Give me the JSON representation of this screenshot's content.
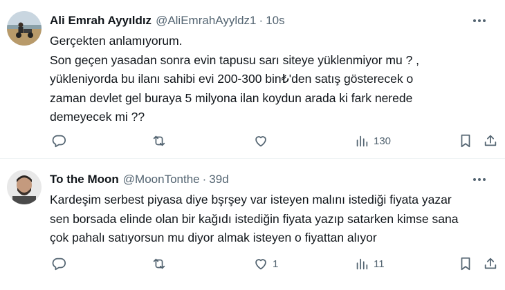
{
  "tweets": [
    {
      "name": "Ali Emrah Ayyıldız",
      "handle": "@AliEmrahAyyldz1",
      "separator": "·",
      "time": "10s",
      "more_icon": "ellipsis-icon",
      "lines": [
        "Gerçekten anlamıyorum.",
        "Son geçen yasadan sonra evin tapusu sarı siteye yüklenmiyor mu ? ,",
        "yükleniyorda bu ilanı sahibi evi 200-300 bin₺'den satış gösterecek o",
        "zaman devlet gel buraya 5 milyona ilan koydun arada ki fark nerede",
        "demeyecek mi ??"
      ],
      "actions": {
        "reply": "",
        "retweet": "",
        "like": "",
        "views": "130"
      }
    },
    {
      "name": "To the Moon",
      "handle": "@MoonTonthe",
      "separator": "·",
      "time": "39d",
      "more_icon": "ellipsis-icon",
      "lines": [
        "Kardeşim serbest piyasa diye bşrşey var isteyen malını istediği fiyata yazar",
        "sen borsada elinde olan bir kağıdı istediğin fiyata yazıp satarken kimse sana",
        "çok pahalı satıyorsun mu diyor almak isteyen o fiyattan alıyor"
      ],
      "actions": {
        "reply": "",
        "retweet": "",
        "like": "1",
        "views": "11"
      }
    }
  ],
  "colors": {
    "text": "#0f1419",
    "secondary": "#536471",
    "divider": "#eff3f4"
  }
}
